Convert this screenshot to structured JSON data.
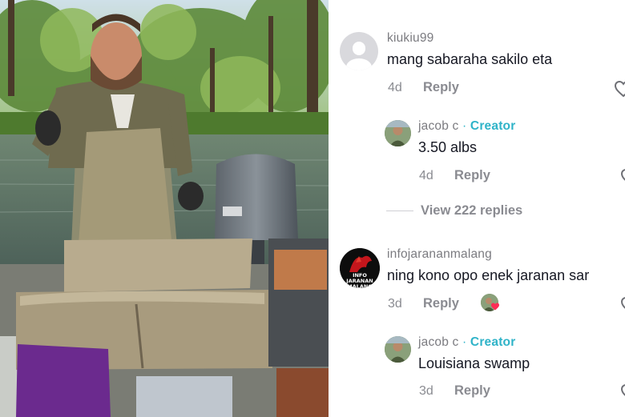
{
  "comments": [
    {
      "username": "kiukiu99",
      "text": "mang sabaraha sakilo eta",
      "age": "4d",
      "reply_label": "Reply",
      "avatar": "default-avatar-icon"
    },
    {
      "username": "jacob c",
      "separator": "·",
      "badge": "Creator",
      "text": "3.50 albs",
      "age": "4d",
      "reply_label": "Reply",
      "avatar": "creator-avatar"
    },
    {
      "username": "infojarananmalang",
      "text": "ning kono opo enek jaranan sar",
      "age": "3d",
      "reply_label": "Reply",
      "avatar": "infojaranan-logo",
      "avatar_text": "INFO JARANAN MALANG"
    },
    {
      "username": "jacob c",
      "separator": "·",
      "badge": "Creator",
      "text": "Louisiana swamp",
      "age": "3d",
      "reply_label": "Reply",
      "avatar": "creator-avatar"
    }
  ],
  "view_replies_label": "View 222 replies",
  "colors": {
    "creator": "#2fb3c8",
    "meta": "#8a8b91",
    "text": "#161823",
    "liked_heart": "#fe2c55"
  }
}
